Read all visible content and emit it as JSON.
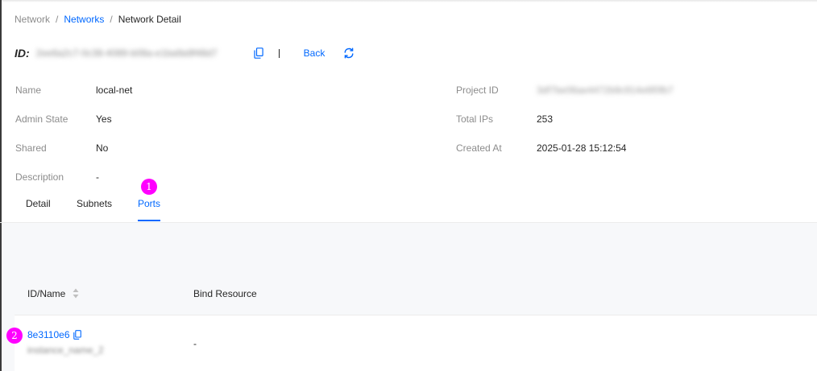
{
  "breadcrumb": {
    "root": "Network",
    "parent": "Networks",
    "current": "Network Detail",
    "separator": "/"
  },
  "header": {
    "id_label": "ID:",
    "id_value": "2ee6a2c7-0c38-4089-b08a-e1ba9a9f48d7",
    "back_label": "Back",
    "divider": "|"
  },
  "info_left": [
    {
      "key": "Name",
      "value": "local-net"
    },
    {
      "key": "Admin State",
      "value": "Yes"
    },
    {
      "key": "Shared",
      "value": "No"
    },
    {
      "key": "Description",
      "value": "-"
    }
  ],
  "info_right": [
    {
      "key": "Project ID",
      "value": "3df7be06ae4472b9c914e6f0fb7"
    },
    {
      "key": "Total IPs",
      "value": "253"
    },
    {
      "key": "Created At",
      "value": "2025-01-28 15:12:54"
    }
  ],
  "tabs": [
    {
      "label": "Detail",
      "active": false
    },
    {
      "label": "Subnets",
      "active": false
    },
    {
      "label": "Ports",
      "active": true
    }
  ],
  "table": {
    "headers": [
      "ID/Name",
      "Bind Resource"
    ],
    "rows": [
      {
        "id": "8e3110e6",
        "name": "instance_name_2",
        "bind_resource": "-"
      }
    ]
  },
  "markers": [
    "1",
    "2"
  ],
  "icons": {
    "copy": "copy-icon",
    "refresh": "refresh-icon",
    "sort": "sort-icon"
  },
  "colors": {
    "link": "#0068ff",
    "muted": "#8c8c8c",
    "text": "#262626",
    "marker": "#ff00ff",
    "table_header_bg": "#f7f8fa"
  }
}
